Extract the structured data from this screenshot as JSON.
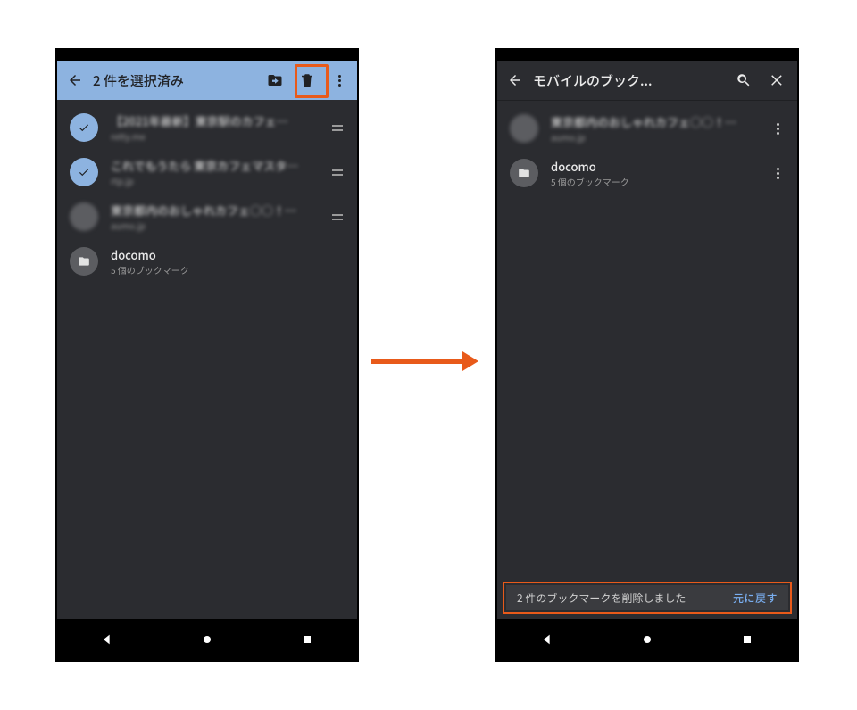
{
  "left": {
    "appbar": {
      "title": "2 件を選択済み"
    },
    "items": [
      {
        "title": "【2021年最新】東京駅のカフェ…",
        "subtitle": "retty.me",
        "selected": true,
        "draggable": true,
        "type": "page"
      },
      {
        "title": "これでもうたら 東京カフェマスタ…",
        "subtitle": "rtp.jp",
        "selected": true,
        "draggable": true,
        "type": "page"
      },
      {
        "title": "東京都内のおしゃれカフェ○○！…",
        "subtitle": "aumo.jp",
        "selected": false,
        "draggable": true,
        "type": "page"
      },
      {
        "title": "docomo",
        "subtitle": "5 個のブックマーク",
        "selected": false,
        "draggable": false,
        "type": "folder"
      }
    ]
  },
  "right": {
    "appbar": {
      "title": "モバイルのブック..."
    },
    "items": [
      {
        "title": "東京都内のおしゃれカフェ○○！…",
        "subtitle": "aumo.jp",
        "type": "page"
      },
      {
        "title": "docomo",
        "subtitle": "5 個のブックマーク",
        "type": "folder"
      }
    ],
    "snackbar": {
      "message": "2 件のブックマークを削除しました",
      "action": "元に戻す"
    }
  }
}
